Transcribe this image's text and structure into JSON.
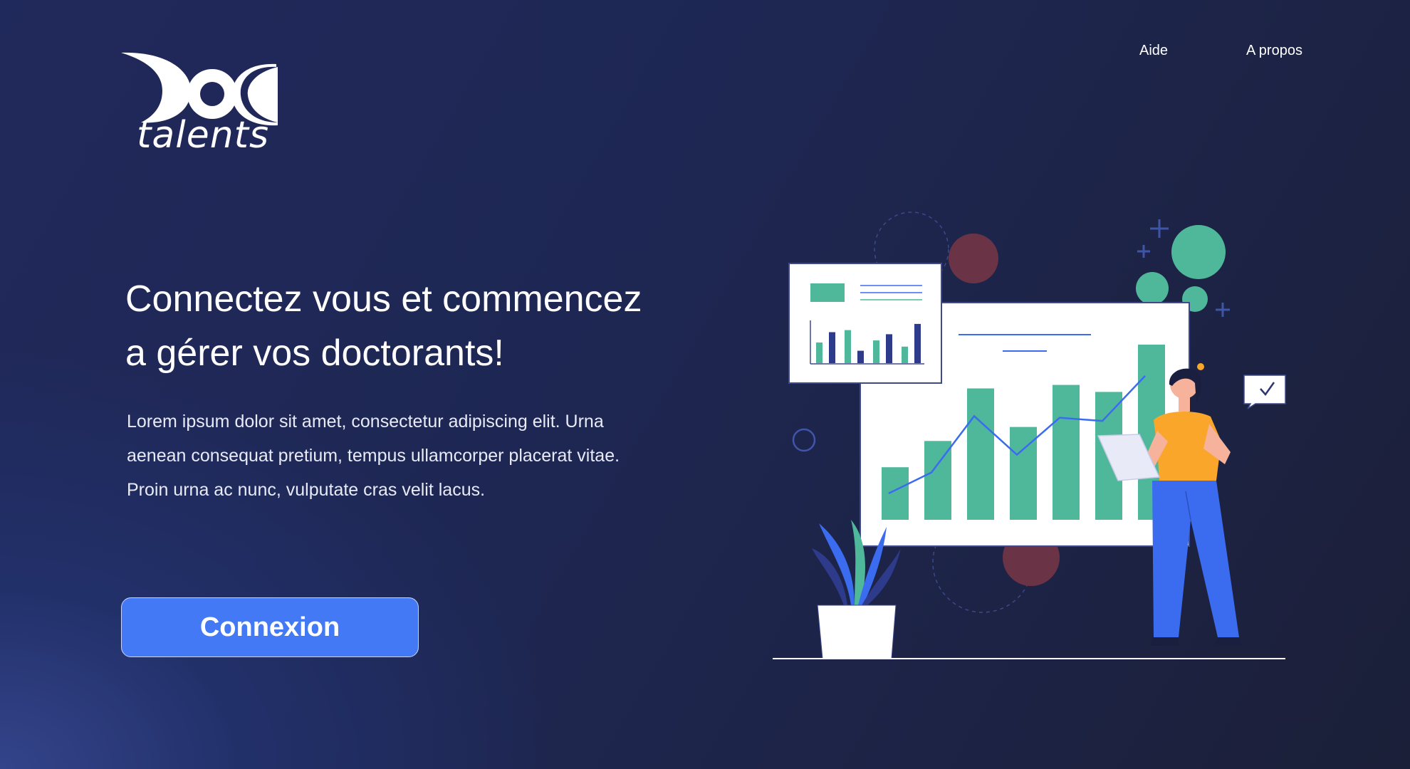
{
  "logo": {
    "wordmark": "talents",
    "monogram": "DOC"
  },
  "nav": {
    "items": [
      {
        "label": "Aide"
      },
      {
        "label": "A propos"
      }
    ]
  },
  "hero": {
    "headline_line1": "Connectez vous et commencez",
    "headline_line2": "a gérer vos doctorants!",
    "description": "Lorem ipsum dolor sit amet, consectetur adipiscing elit. Urna aenean consequat pretium, tempus ullamcorper placerat vitae. Proin urna ac nunc, vulputate cras velit lacus.",
    "login_label": "Connexion"
  },
  "colors": {
    "accent": "#4479f5",
    "chart_green": "#4fb89b",
    "chart_line": "#3b6cf0",
    "decor_red": "#6b3346",
    "person_shirt": "#f9a62b",
    "person_pants": "#3b6cf0"
  },
  "illustration": {
    "main_bars": [
      0.3,
      0.45,
      0.75,
      0.53,
      0.77,
      0.73,
      1.0
    ],
    "line_points": [
      0.12,
      0.25,
      0.6,
      0.36,
      0.59,
      0.57,
      0.85
    ],
    "small_panel_bars": [
      0.5,
      0.75,
      0.8,
      0.3,
      0.55,
      0.7,
      0.4,
      0.95
    ]
  }
}
